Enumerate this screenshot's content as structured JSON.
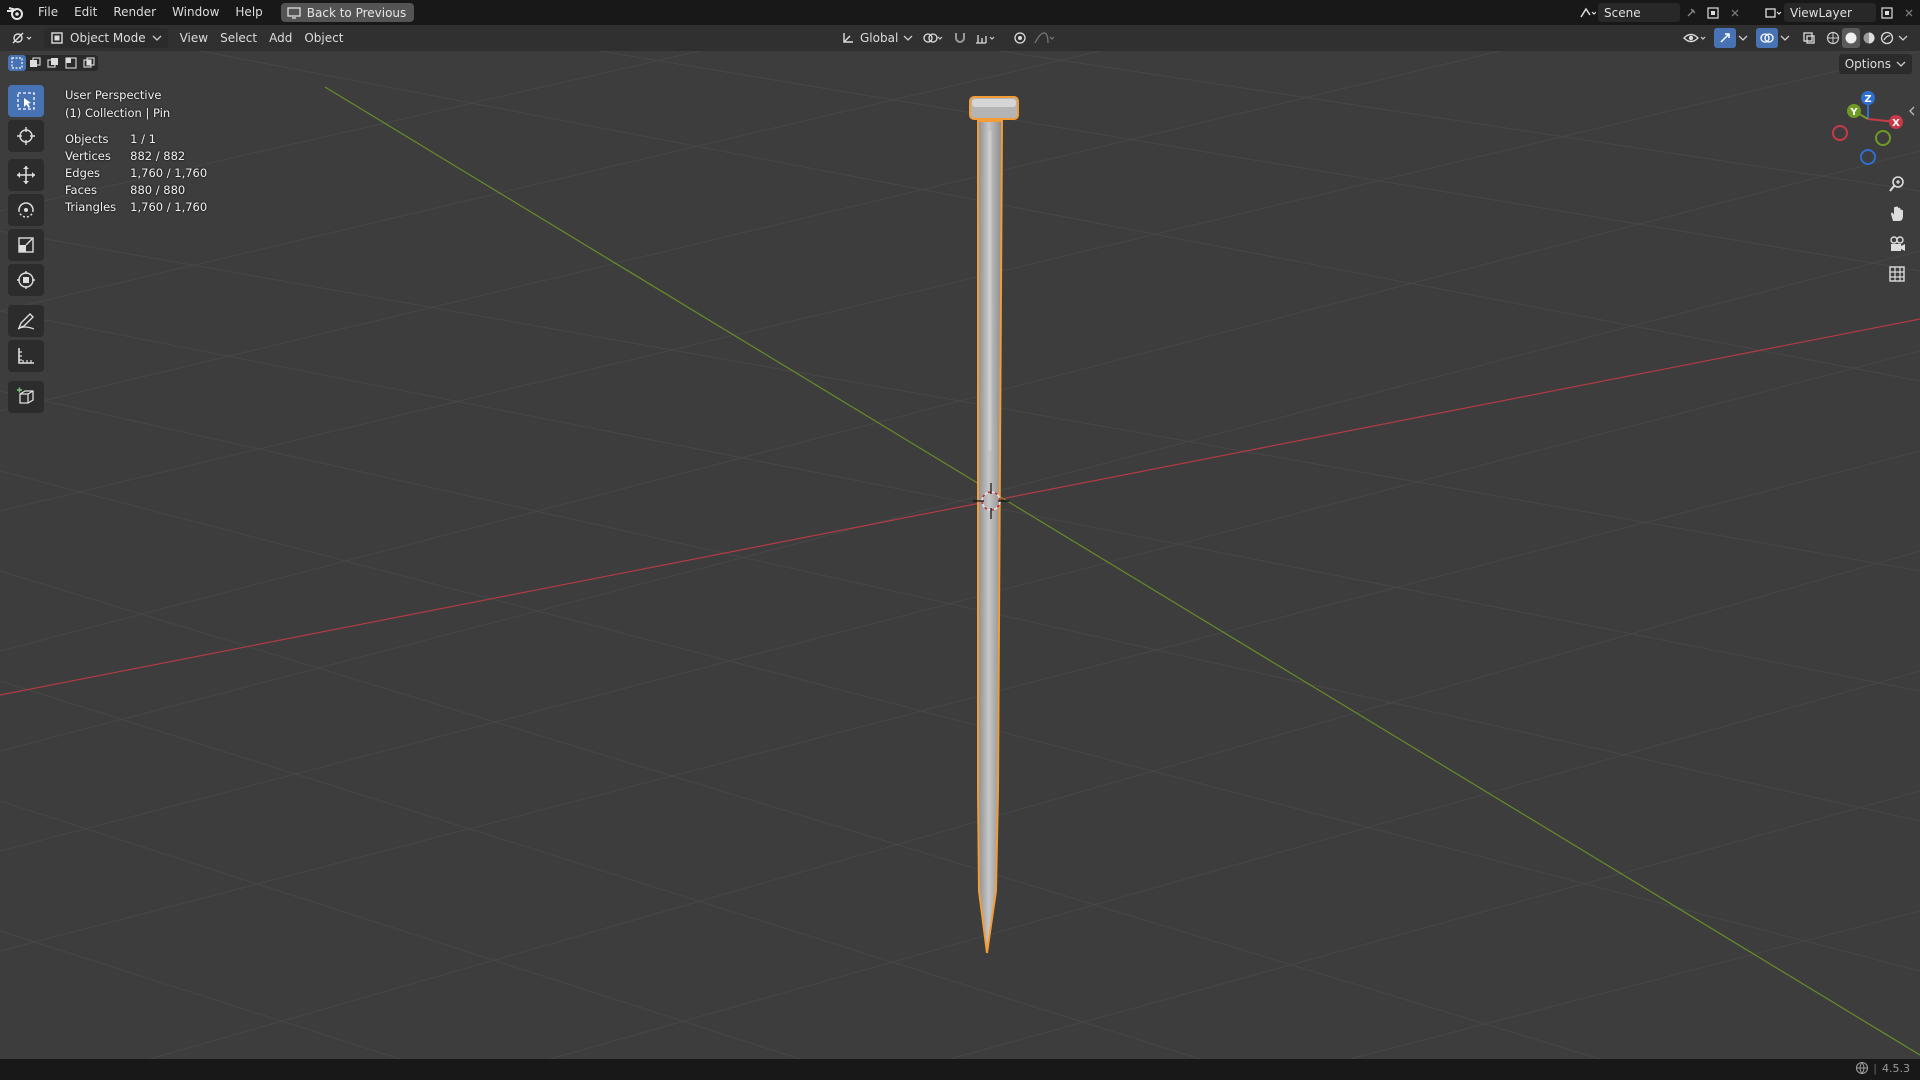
{
  "menubar": {
    "items": [
      "File",
      "Edit",
      "Render",
      "Window",
      "Help"
    ],
    "back_button": "Back to Previous",
    "scene": "Scene",
    "view_layer": "ViewLayer"
  },
  "header": {
    "mode": "Object Mode",
    "menus": [
      "View",
      "Select",
      "Add",
      "Object"
    ],
    "orientation": "Global",
    "options": "Options"
  },
  "viewport": {
    "perspective": "User Perspective",
    "collection": "(1) Collection | Pin",
    "stats": [
      {
        "label": "Objects",
        "value": "1 / 1"
      },
      {
        "label": "Vertices",
        "value": "882 / 882"
      },
      {
        "label": "Edges",
        "value": "1,760 / 1,760"
      },
      {
        "label": "Faces",
        "value": "880 / 880"
      },
      {
        "label": "Triangles",
        "value": "1,760 / 1,760"
      }
    ],
    "gizmo_axes": [
      "Z",
      "Y",
      "X"
    ]
  },
  "status": {
    "version": "4.5.3"
  },
  "colors": {
    "selection_outline": "#f29d38",
    "x_axis": "#c83a48",
    "y_axis": "#6f9a24",
    "active_tool": "#4772b3"
  }
}
